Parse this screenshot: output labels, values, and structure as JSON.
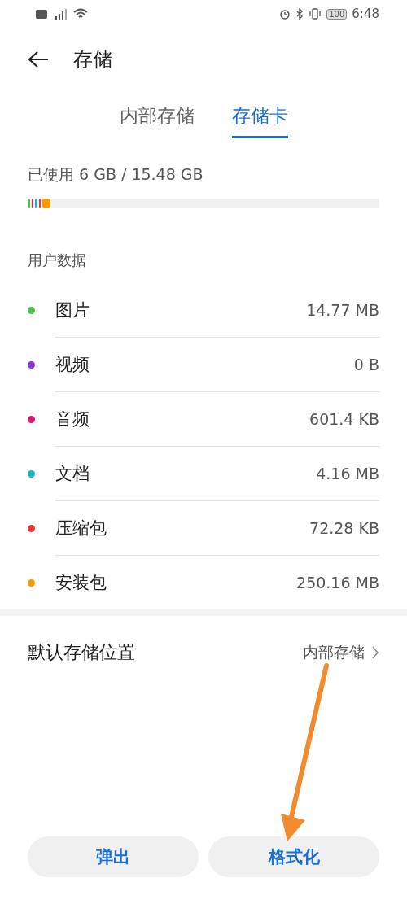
{
  "status_bar": {
    "time": "6:48",
    "battery": "100"
  },
  "header": {
    "title": "存储"
  },
  "tabs": [
    {
      "label": "内部存储",
      "selected": false
    },
    {
      "label": "存储卡",
      "selected": true
    }
  ],
  "usage": {
    "text": "已使用 6 GB / 15.48 GB",
    "segments": [
      {
        "color": "#4cbf4c",
        "level": 0.006
      },
      {
        "color": "#d8196b",
        "level": 0.006
      },
      {
        "color": "#20b3c2",
        "level": 0.006
      },
      {
        "color": "#e53935",
        "level": 0.006
      },
      {
        "color": "#f59c00",
        "level": 0.022
      }
    ]
  },
  "section_title": "用户数据",
  "categories": [
    {
      "name": "图片",
      "size": "14.77 MB",
      "color": "#4cbf4c"
    },
    {
      "name": "视频",
      "size": "0 B",
      "color": "#8a35d6"
    },
    {
      "name": "音频",
      "size": "601.4 KB",
      "color": "#d8196b"
    },
    {
      "name": "文档",
      "size": "4.16 MB",
      "color": "#20b3c2"
    },
    {
      "name": "压缩包",
      "size": "72.28 KB",
      "color": "#e53935"
    },
    {
      "name": "安装包",
      "size": "250.16 MB",
      "color": "#f59c00"
    }
  ],
  "default_location": {
    "label": "默认存储位置",
    "value": "内部存储"
  },
  "buttons": [
    "弹出",
    "格式化"
  ]
}
